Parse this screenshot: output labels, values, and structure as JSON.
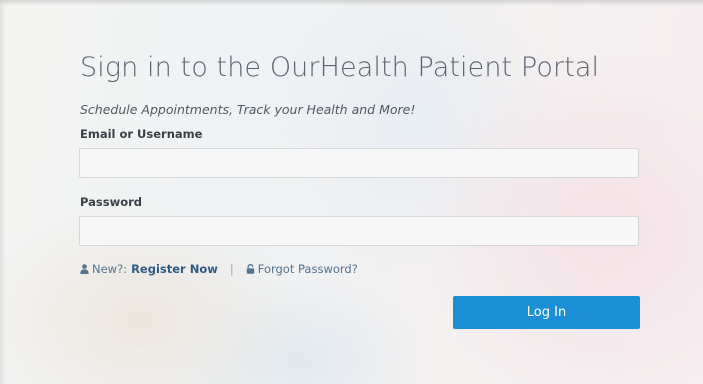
{
  "portal": {
    "title": "Sign in to the OurHealth Patient Portal",
    "subtitle": "Schedule Appointments, Track your Health and More!"
  },
  "form": {
    "email_label": "Email or Username",
    "email_value": "",
    "password_label": "Password",
    "password_value": "",
    "new_prefix": "New?:",
    "register_label": "Register Now",
    "separator": "|",
    "forgot_label": "Forgot Password?",
    "login_label": "Log In"
  },
  "icons": {
    "new_user": "user-icon",
    "forgot": "lock-icon"
  },
  "colors": {
    "primary_button": "#1a8fd6",
    "link": "#2e5a84"
  }
}
